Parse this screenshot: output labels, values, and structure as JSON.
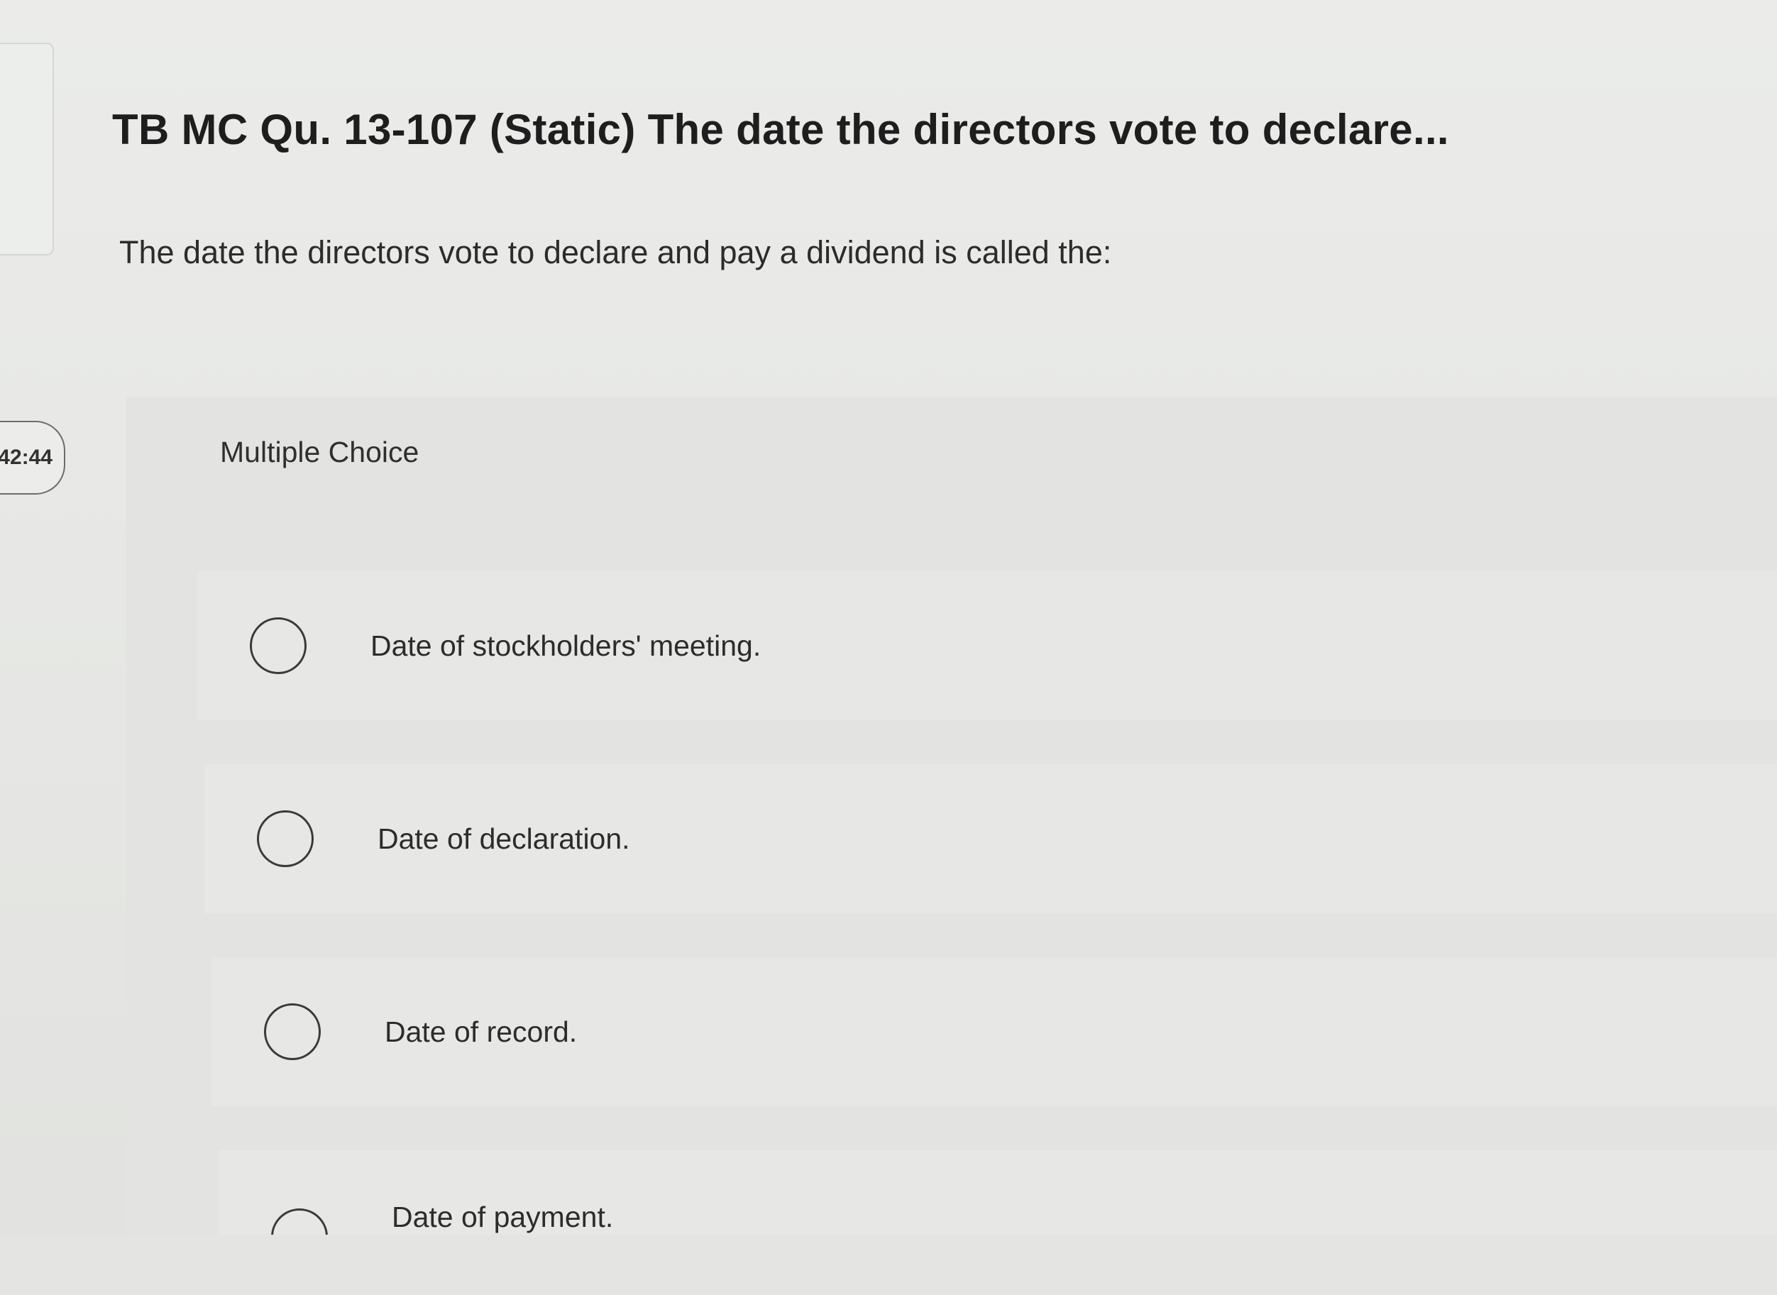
{
  "timer": {
    "value": "42:44"
  },
  "question": {
    "title": "TB MC Qu. 13-107 (Static) The date the directors vote to declare...",
    "prompt": "The date the directors vote to declare and pay a dividend is called the:"
  },
  "choices": {
    "type_label": "Multiple Choice",
    "options": [
      {
        "label": "Date of stockholders' meeting."
      },
      {
        "label": "Date of declaration."
      },
      {
        "label": "Date of record."
      },
      {
        "label": "Date of payment."
      }
    ]
  }
}
